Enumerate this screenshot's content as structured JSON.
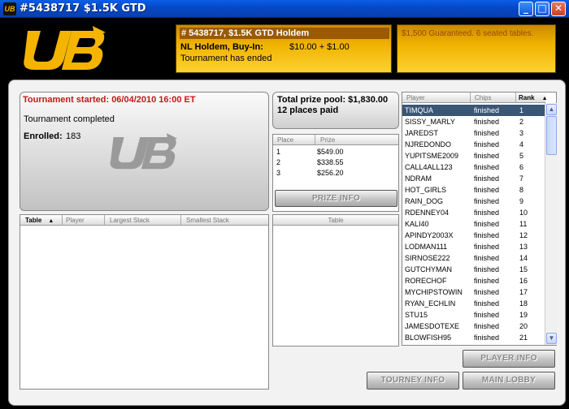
{
  "window": {
    "title": "#5438717 $1.5K GTD",
    "app_icon_text": "UB",
    "minimize": "_",
    "maximize": "□",
    "close": "✕"
  },
  "header": {
    "logo_icon": "ub-logo-icon",
    "tourney_title": "# 5438717, $1.5K GTD  Holdem",
    "game_label": "NL Holdem, Buy-In:",
    "buyin": "$10.00 + $1.00",
    "status": "Tournament has ended",
    "guarantee_text": "$1,500 Guaranteed. 6 seated tables."
  },
  "info": {
    "started": "Tournament started:  06/04/2010 16:00 ET",
    "completed": "Tournament completed",
    "enrolled_label": "Enrolled:",
    "enrolled_value": "183"
  },
  "prize": {
    "pool_line": "Total prize pool:  $1,830.00",
    "paid_line": "12 places paid",
    "headers": {
      "place": "Place",
      "prize": "Prize"
    },
    "rows": [
      {
        "place": "1",
        "prize": "$549.00"
      },
      {
        "place": "2",
        "prize": "$338.55"
      },
      {
        "place": "3",
        "prize": "$256.20"
      }
    ],
    "button": "PRIZE INFO"
  },
  "tables": {
    "headers": {
      "table": "Table",
      "player": "Player",
      "largest": "Largest Stack",
      "smallest": "Smallest Stack"
    },
    "sort_indicator": "▲"
  },
  "table_list": {
    "header": "Table"
  },
  "players": {
    "headers": {
      "player": "Player",
      "chips": "Chips",
      "rank": "Rank"
    },
    "sort_indicator": "▲",
    "rows": [
      {
        "name": "TIMQUA",
        "status": "finished",
        "rank": "1"
      },
      {
        "name": "SISSY_MARLY",
        "status": "finished",
        "rank": "2"
      },
      {
        "name": "JAREDST",
        "status": "finished",
        "rank": "3"
      },
      {
        "name": "NJREDONDO",
        "status": "finished",
        "rank": "4"
      },
      {
        "name": "YUPITSME2009",
        "status": "finished",
        "rank": "5"
      },
      {
        "name": "CALL4ALL123",
        "status": "finished",
        "rank": "6"
      },
      {
        "name": "NDRAM",
        "status": "finished",
        "rank": "7"
      },
      {
        "name": "HOT_GIRLS",
        "status": "finished",
        "rank": "8"
      },
      {
        "name": "RAIN_DOG",
        "status": "finished",
        "rank": "9"
      },
      {
        "name": "RDENNEY04",
        "status": "finished",
        "rank": "10"
      },
      {
        "name": "KALI40",
        "status": "finished",
        "rank": "11"
      },
      {
        "name": "APINDY2003X",
        "status": "finished",
        "rank": "12"
      },
      {
        "name": "LODMAN111",
        "status": "finished",
        "rank": "13"
      },
      {
        "name": "SIRNOSE222",
        "status": "finished",
        "rank": "14"
      },
      {
        "name": "GUTCHYMAN",
        "status": "finished",
        "rank": "15"
      },
      {
        "name": "RORECHOF",
        "status": "finished",
        "rank": "16"
      },
      {
        "name": "MYCHIPSTOWIN",
        "status": "finished",
        "rank": "17"
      },
      {
        "name": "RYAN_ECHLIN",
        "status": "finished",
        "rank": "18"
      },
      {
        "name": "STU15",
        "status": "finished",
        "rank": "19"
      },
      {
        "name": "JAMESDOTEXE",
        "status": "finished",
        "rank": "20"
      },
      {
        "name": "BLOWFISH95",
        "status": "finished",
        "rank": "21"
      }
    ],
    "scroll_up": "▲",
    "scroll_down": "▼"
  },
  "buttons": {
    "player_info": "PLAYER INFO",
    "tourney_info": "TOURNEY INFO",
    "main_lobby": "MAIN LOBBY"
  },
  "colors": {
    "title_bar": "#0548c4",
    "gold": "#f0b200",
    "started_red": "#c41818",
    "selected_row": "#3a5676"
  }
}
